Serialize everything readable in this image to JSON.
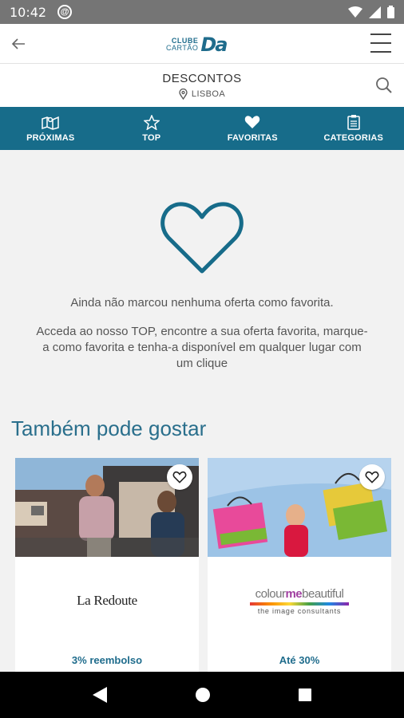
{
  "status_bar": {
    "time": "10:42",
    "notification_icon": "at-sign-icon"
  },
  "app_bar": {
    "logo_line1": "CLUBE",
    "logo_line2": "CARTÃO",
    "logo_mark": "Da",
    "back_icon": "arrow-left-icon",
    "menu_icon": "hamburger-icon"
  },
  "header": {
    "title": "DESCONTOS",
    "location": "LISBOA",
    "search_icon": "search-icon"
  },
  "tabs": [
    {
      "label": "PRÓXIMAS",
      "icon": "map-icon"
    },
    {
      "label": "TOP",
      "icon": "star-icon"
    },
    {
      "label": "FAVORITAS",
      "icon": "heart-icon"
    },
    {
      "label": "CATEGORIAS",
      "icon": "clipboard-icon"
    }
  ],
  "empty_state": {
    "message": "Ainda não marcou nenhuma oferta como favorita.",
    "description": "Acceda ao nosso TOP, encontre a sua oferta favorita, marque-a como favorita e tenha-a disponível em qualquer lugar com um clique"
  },
  "recommendations": {
    "title": "Também pode gostar",
    "cards": [
      {
        "brand": "La Redoute",
        "offer": "3% reembolso"
      },
      {
        "brand_parts": [
          "colour",
          "me",
          "beautiful"
        ],
        "brand_sub": "the image consultants",
        "offer": "Até 30%"
      }
    ]
  },
  "colors": {
    "primary": "#176c8a",
    "accent_text": "#2a6f8c",
    "background": "#f2f2f2"
  }
}
